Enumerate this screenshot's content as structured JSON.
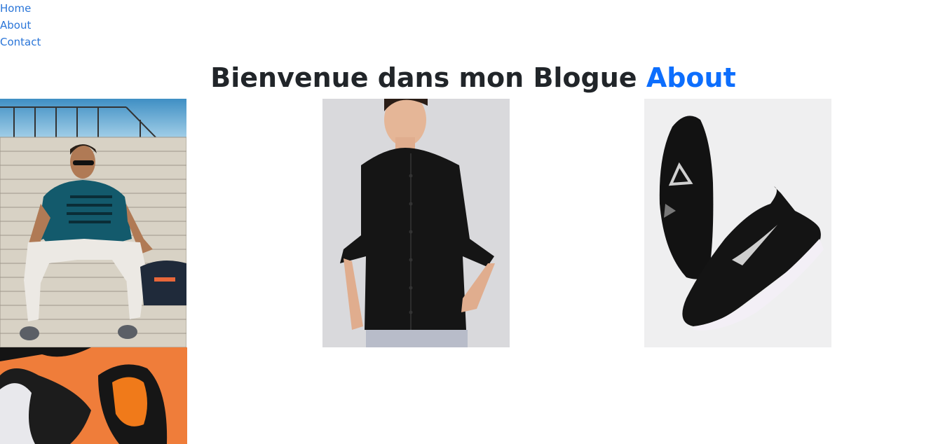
{
  "nav": {
    "items": [
      {
        "label": "Home"
      },
      {
        "label": "About"
      },
      {
        "label": "Contact"
      }
    ]
  },
  "header": {
    "title_main": "Bienvenue dans mon Blogue",
    "title_accent": "About"
  },
  "colors": {
    "link": "#2a75d8",
    "title": "#212529",
    "accent": "#0d6efd"
  }
}
